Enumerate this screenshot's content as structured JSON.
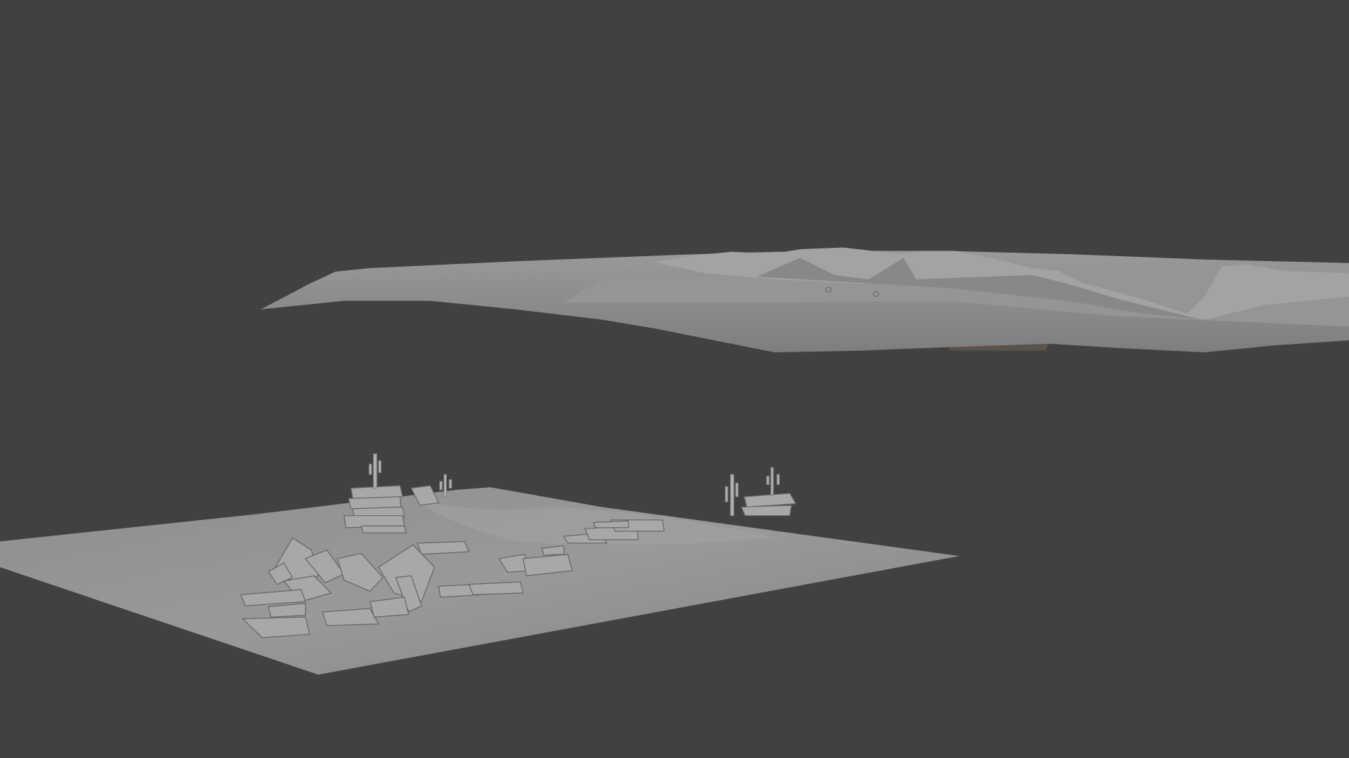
{
  "viewport": {
    "background_color": "#414141",
    "terrain_color": "#8f8f8f",
    "terrain_shadow_color": "#7a7a7a",
    "rock_color": "#a6a6a6",
    "rock_dark_color": "#6e6e6e"
  }
}
